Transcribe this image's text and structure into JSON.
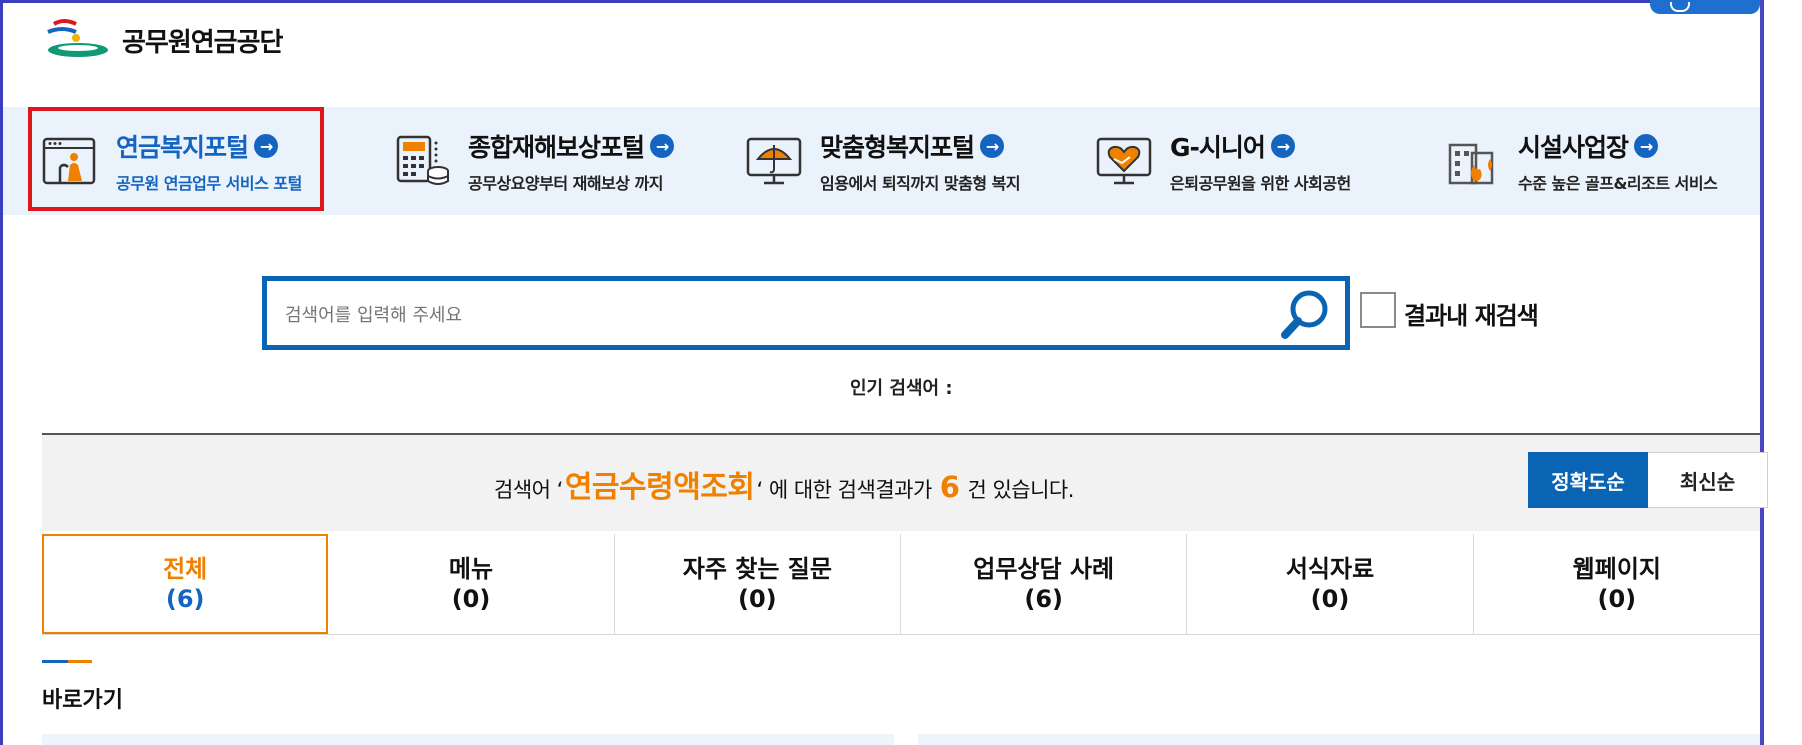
{
  "header": {
    "logo_text": "공무원연금공단"
  },
  "portals": [
    {
      "title": "연금복지포털",
      "subtitle": "공무원 연금업무 서비스 포털",
      "icon": "elderly-screen-icon",
      "active": true
    },
    {
      "title": "종합재해보상포털",
      "subtitle": "공무상요양부터 재해보상 까지",
      "icon": "calculator-coins-icon",
      "active": false
    },
    {
      "title": "맞춤형복지포털",
      "subtitle": "임용에서 퇴직까지 맞춤형 복지",
      "icon": "umbrella-monitor-icon",
      "active": false
    },
    {
      "title": "G-시니어",
      "subtitle": "은퇴공무원을 위한 사회공헌",
      "icon": "handshake-heart-icon",
      "active": false
    },
    {
      "title": "시설사업장",
      "subtitle": "수준 높은 골프&리조트 서비스",
      "icon": "building-flame-icon",
      "active": false
    }
  ],
  "search": {
    "placeholder": "검색어를 입력해 주세요",
    "recheck_label": "결과내 재검색",
    "popular_label": "인기 검색어 :"
  },
  "result": {
    "prefix": "검색어 ‘",
    "query": "연금수령액조회",
    "middle": "‘ 에 대한 검색결과가",
    "count": "6",
    "suffix": "건 있습니다.",
    "sort_options": [
      "정확도순",
      "최신순"
    ]
  },
  "tabs": [
    {
      "label": "전체",
      "count": "(6)",
      "active": true
    },
    {
      "label": "메뉴",
      "count": "(0)",
      "active": false
    },
    {
      "label": "자주 찾는 질문",
      "count": "(0)",
      "active": false
    },
    {
      "label": "업무상담 사례",
      "count": "(6)",
      "active": false
    },
    {
      "label": "서식자료",
      "count": "(0)",
      "active": false
    },
    {
      "label": "웹페이지",
      "count": "(0)",
      "active": false
    }
  ],
  "shortcuts": {
    "title": "바로가기"
  },
  "colors": {
    "accent_blue": "#0a64b4",
    "accent_orange": "#f08100",
    "active_outline": "#e0161f",
    "portal_band": "#eaf3fc"
  }
}
